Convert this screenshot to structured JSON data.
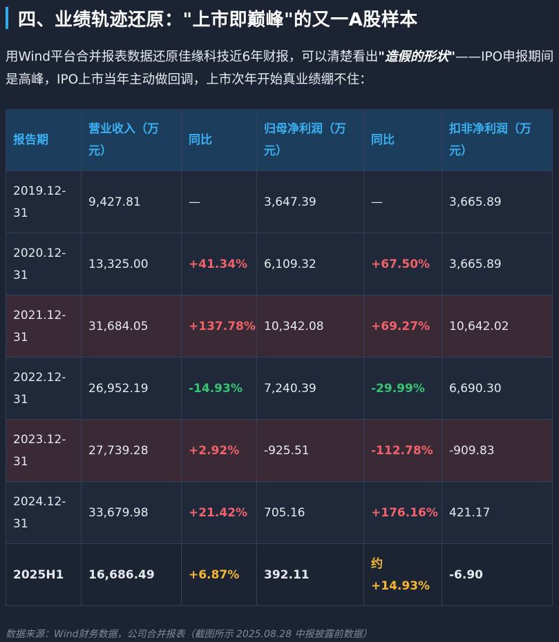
{
  "heading": {
    "title": "四、业绩轨迹还原：\"上市即巅峰\"的又一A股样本"
  },
  "intro": {
    "before": "用Wind平台合并报表数据还原佳缘科技近6年财报，可以清楚看出",
    "emphasis": "\"造假的形状\"",
    "after": "——IPO申报期间是高峰，IPO上市当年主动做回调，上市次年开始真业绩绷不住："
  },
  "table": {
    "headers": [
      "报告期",
      "营业收入（万元）",
      "同比",
      "归母净利润（万元）",
      "同比",
      "扣非净利润（万元）"
    ],
    "rows": [
      {
        "period": "2019.12-31",
        "revenue": "9,427.81",
        "revenue_yoy": "—",
        "net_profit": "3,647.39",
        "net_profit_yoy": "—",
        "deducted_profit": "3,665.89"
      },
      {
        "period": "2020.12-31",
        "revenue": "13,325.00",
        "revenue_yoy": "+41.34%",
        "net_profit": "6,109.32",
        "net_profit_yoy": "+67.50%",
        "deducted_profit": "3,665.89"
      },
      {
        "period": "2021.12-31",
        "revenue": "31,684.05",
        "revenue_yoy": "+137.78%",
        "net_profit": "10,342.08",
        "net_profit_yoy": "+69.27%",
        "deducted_profit": "10,642.02"
      },
      {
        "period": "2022.12-31",
        "revenue": "26,952.19",
        "revenue_yoy": "-14.93%",
        "net_profit": "7,240.39",
        "net_profit_yoy": "-29.99%",
        "deducted_profit": "6,690.30"
      },
      {
        "period": "2023.12-31",
        "revenue": "27,739.28",
        "revenue_yoy": "+2.92%",
        "net_profit": "-925.51",
        "net_profit_yoy": "-112.78%",
        "deducted_profit": "-909.83"
      },
      {
        "period": "2024.12-31",
        "revenue": "33,679.98",
        "revenue_yoy": "+21.42%",
        "net_profit": "705.16",
        "net_profit_yoy": "+176.16%",
        "deducted_profit": "421.17"
      },
      {
        "period": "2025H1",
        "revenue": "16,686.49",
        "revenue_yoy": "+6.87%",
        "net_profit": "392.11",
        "net_profit_yoy": "约+14.93%",
        "deducted_profit": "-6.90"
      }
    ]
  },
  "source": {
    "text": "数据来源：Wind财务数据，公司合并报表（截图所示 2025.08.28 中报披露前数据）"
  },
  "colors": {
    "accent": "#35a9e9",
    "header_text": "#3ab0f2",
    "positive": "#f0636a",
    "negative": "#34c472",
    "highlight_row": "#f19a96",
    "latest_row": "#f5b731"
  }
}
